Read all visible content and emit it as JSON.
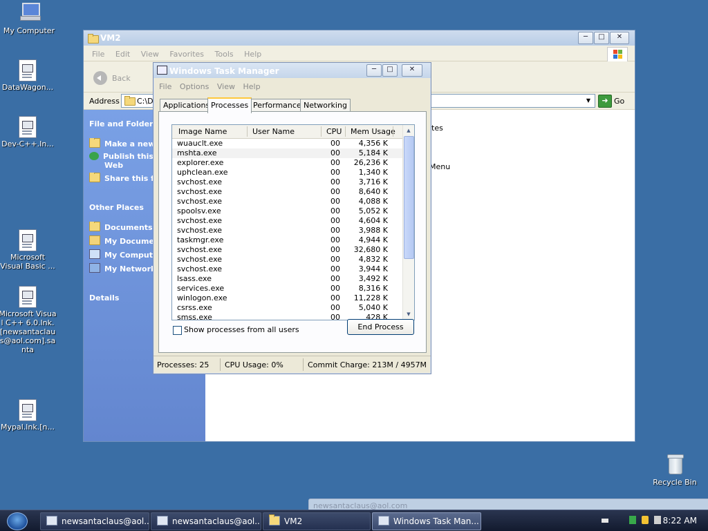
{
  "desktop": {
    "icons": [
      {
        "label": "My Computer"
      },
      {
        "label": "DataWagon..."
      },
      {
        "label": "Dev-C++.In..."
      },
      {
        "label": "Microsoft Visual Basic ..."
      },
      {
        "label": "Microsoft Visual C++ 6.0.lnk.[newsantaclaus@aol.com].santa"
      },
      {
        "label": "Mypal.lnk.[n..."
      },
      {
        "label": "Recycle Bin"
      }
    ]
  },
  "explorer": {
    "title": "VM2",
    "menu": [
      "File",
      "Edit",
      "View",
      "Favorites",
      "Tools",
      "Help"
    ],
    "back_label": "Back",
    "address_label": "Address",
    "address_value": "C:\\D",
    "go_label": "Go",
    "taskpane": {
      "file_folder_tasks": "File and Folder Ta",
      "tasks": [
        "Make a new f",
        "Publish this fo",
        "Web",
        "Share this fol"
      ],
      "other_places": "Other Places",
      "places": [
        "Documents ar",
        "My Document",
        "My Computer",
        "My Network P"
      ],
      "details": "Details"
    },
    "content_fragments": [
      "tes",
      "Menu"
    ]
  },
  "taskmanager": {
    "title": "Windows Task Manager",
    "menu": [
      "File",
      "Options",
      "View",
      "Help"
    ],
    "tabs": [
      "Applications",
      "Processes",
      "Performance",
      "Networking"
    ],
    "selected_tab": "Processes",
    "columns": [
      "Image Name",
      "User Name",
      "CPU",
      "Mem Usage"
    ],
    "processes": [
      {
        "name": "wuauclt.exe",
        "user": "",
        "cpu": "00",
        "mem": "4,356 K"
      },
      {
        "name": "mshta.exe",
        "user": "",
        "cpu": "00",
        "mem": "5,184 K"
      },
      {
        "name": "explorer.exe",
        "user": "",
        "cpu": "00",
        "mem": "26,236 K"
      },
      {
        "name": "uphclean.exe",
        "user": "",
        "cpu": "00",
        "mem": "1,340 K"
      },
      {
        "name": "svchost.exe",
        "user": "",
        "cpu": "00",
        "mem": "3,716 K"
      },
      {
        "name": "svchost.exe",
        "user": "",
        "cpu": "00",
        "mem": "8,640 K"
      },
      {
        "name": "svchost.exe",
        "user": "",
        "cpu": "00",
        "mem": "4,088 K"
      },
      {
        "name": "spoolsv.exe",
        "user": "",
        "cpu": "00",
        "mem": "5,052 K"
      },
      {
        "name": "svchost.exe",
        "user": "",
        "cpu": "00",
        "mem": "4,604 K"
      },
      {
        "name": "svchost.exe",
        "user": "",
        "cpu": "00",
        "mem": "3,988 K"
      },
      {
        "name": "taskmgr.exe",
        "user": "",
        "cpu": "00",
        "mem": "4,944 K"
      },
      {
        "name": "svchost.exe",
        "user": "",
        "cpu": "00",
        "mem": "32,680 K"
      },
      {
        "name": "svchost.exe",
        "user": "",
        "cpu": "00",
        "mem": "4,832 K"
      },
      {
        "name": "svchost.exe",
        "user": "",
        "cpu": "00",
        "mem": "3,944 K"
      },
      {
        "name": "lsass.exe",
        "user": "",
        "cpu": "00",
        "mem": "3,492 K"
      },
      {
        "name": "services.exe",
        "user": "",
        "cpu": "00",
        "mem": "8,316 K"
      },
      {
        "name": "winlogon.exe",
        "user": "",
        "cpu": "00",
        "mem": "11,228 K"
      },
      {
        "name": "csrss.exe",
        "user": "",
        "cpu": "00",
        "mem": "5,040 K"
      },
      {
        "name": "smss.exe",
        "user": "",
        "cpu": "00",
        "mem": "428 K"
      }
    ],
    "show_all_label": "Show processes from all users",
    "end_process_label": "End Process",
    "status": {
      "processes": "Processes: 25",
      "cpu": "CPU Usage: 0%",
      "commit": "Commit Charge: 213M / 4957M"
    }
  },
  "taskbar": {
    "buttons": [
      {
        "label": "newsantaclaus@aol...."
      },
      {
        "label": "newsantaclaus@aol...."
      },
      {
        "label": "VM2"
      },
      {
        "label": "Windows Task Man..."
      }
    ],
    "clock": "8:22 AM",
    "ghost_label": "newsantaclaus@aol.com"
  },
  "colors": {
    "desktop_bg": "#3a6ea5",
    "taskpane": "#6f93da",
    "tab_highlight": "#ffc83c"
  }
}
